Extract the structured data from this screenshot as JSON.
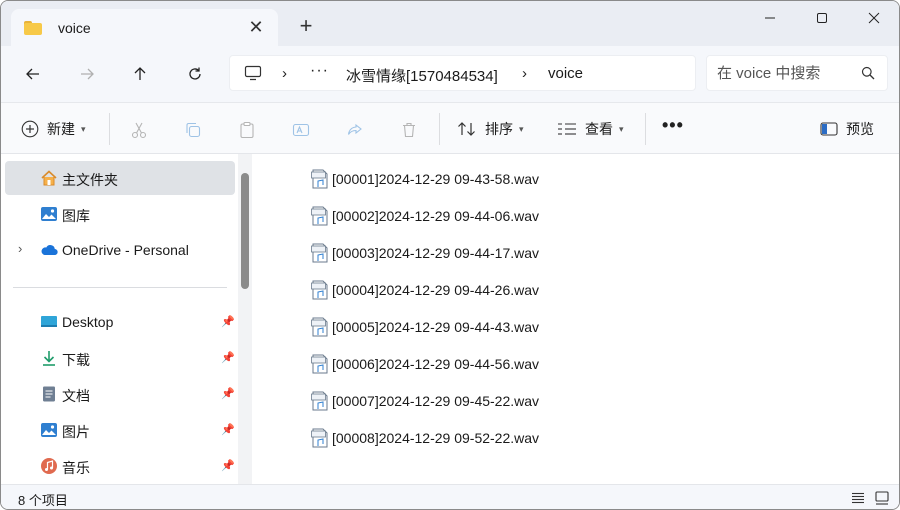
{
  "window": {
    "tab_title": "voice",
    "tab_close": "✕",
    "new_tab": "+"
  },
  "address": {
    "more": "···",
    "path": [
      "冰雪情缘[1570484534]",
      "voice"
    ],
    "search_placeholder": "在 voice 中搜索"
  },
  "toolbar": {
    "new_label": "新建",
    "sort_label": "排序",
    "view_label": "查看",
    "more_label": "•••",
    "preview_label": "预览"
  },
  "sidebar": {
    "items": [
      {
        "label": "主文件夹",
        "icon": "home-icon",
        "selected": true
      },
      {
        "label": "图库",
        "icon": "gallery-icon"
      },
      {
        "label": "OneDrive - Personal",
        "icon": "onedrive-icon"
      },
      {
        "label": "Desktop",
        "icon": "desktop-icon"
      },
      {
        "label": "下载",
        "icon": "download-icon"
      },
      {
        "label": "文档",
        "icon": "documents-icon"
      },
      {
        "label": "图片",
        "icon": "pictures-icon"
      },
      {
        "label": "音乐",
        "icon": "music-icon"
      }
    ]
  },
  "files": [
    {
      "name": "[00001]2024-12-29 09-43-58.wav"
    },
    {
      "name": "[00002]2024-12-29 09-44-06.wav"
    },
    {
      "name": "[00003]2024-12-29 09-44-17.wav"
    },
    {
      "name": "[00004]2024-12-29 09-44-26.wav"
    },
    {
      "name": "[00005]2024-12-29 09-44-43.wav"
    },
    {
      "name": "[00006]2024-12-29 09-44-56.wav"
    },
    {
      "name": "[00007]2024-12-29 09-45-22.wav"
    },
    {
      "name": "[00008]2024-12-29 09-52-22.wav"
    }
  ],
  "status": {
    "count_text": "8 个项目"
  },
  "colors": {
    "accent": "#0067c0",
    "folder": "#f7c948",
    "selected_bg": "#dfe2e6"
  }
}
